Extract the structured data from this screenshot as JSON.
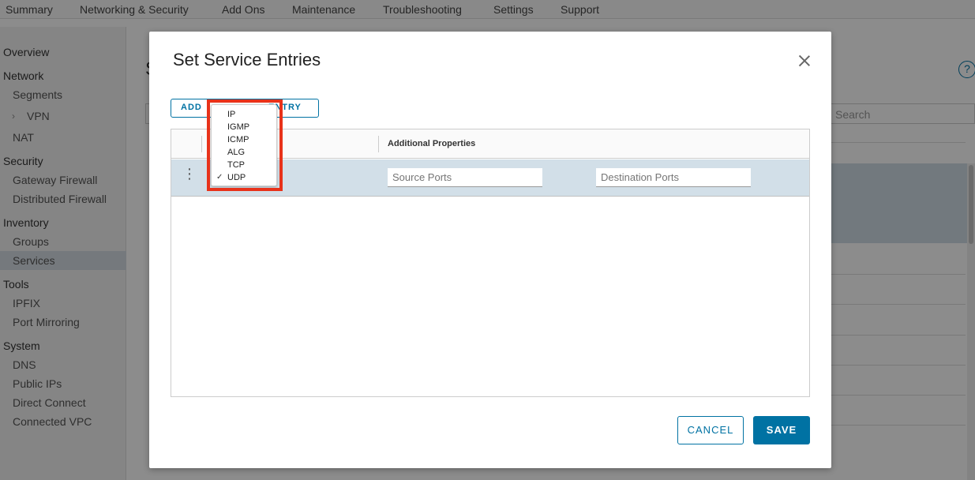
{
  "topnav": {
    "items": [
      "Summary",
      "Networking & Security",
      "Add Ons",
      "Maintenance",
      "Troubleshooting",
      "Settings",
      "Support"
    ]
  },
  "sidebar": {
    "overview": "Overview",
    "network": {
      "label": "Network",
      "items": [
        "Segments",
        "VPN",
        "NAT"
      ]
    },
    "security": {
      "label": "Security",
      "items": [
        "Gateway Firewall",
        "Distributed Firewall"
      ]
    },
    "inventory": {
      "label": "Inventory",
      "items": [
        "Groups",
        "Services"
      ]
    },
    "tools": {
      "label": "Tools",
      "items": [
        "IPFIX",
        "Port Mirroring"
      ]
    },
    "system": {
      "label": "System",
      "items": [
        "DNS",
        "Public IPs",
        "Direct Connect",
        "Connected VPC"
      ]
    },
    "active_item": "Services"
  },
  "background": {
    "title_initial": "S",
    "search_placeholder": "Search",
    "help_glyph": "?"
  },
  "modal": {
    "title": "Set Service Entries",
    "add_button_prefix": "ADD",
    "add_button_suffix": "ENTRY",
    "grid": {
      "column_header": "Additional Properties",
      "row": {
        "source_ports_placeholder": "Source Ports",
        "destination_ports_placeholder": "Destination Ports",
        "menu_glyph": "⋮"
      }
    },
    "dropdown": {
      "options": [
        "IP",
        "IGMP",
        "ICMP",
        "ALG",
        "TCP",
        "UDP"
      ],
      "selected": "UDP"
    },
    "cancel_label": "CANCEL",
    "save_label": "SAVE"
  },
  "colors": {
    "accent": "#0072a3",
    "highlight": "#e8321a",
    "selected_row": "#d2dfe8"
  }
}
